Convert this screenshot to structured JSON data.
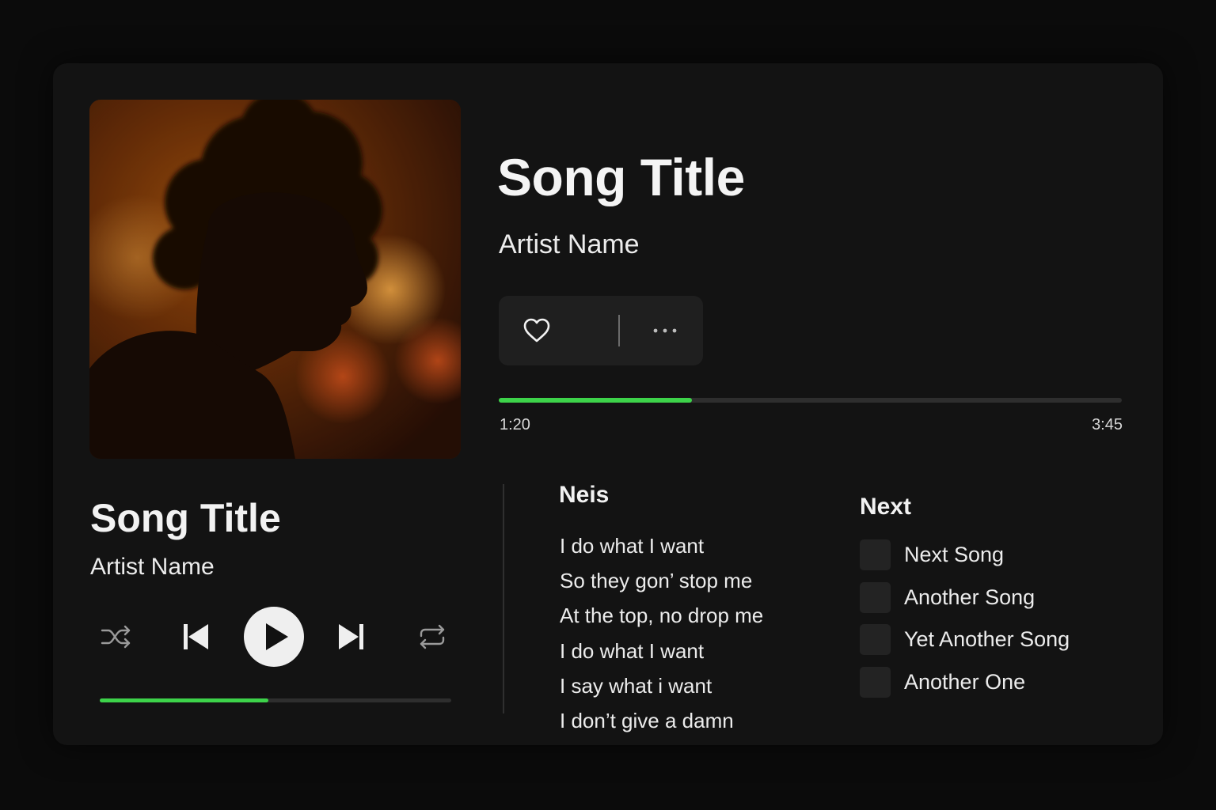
{
  "player": {
    "title": "Song Title",
    "artist": "Artist Name",
    "progress_fraction": 0.31,
    "time_current": "1:20",
    "time_total": "3:45",
    "mini_progress_fraction": 0.48
  },
  "actions": {
    "like_icon": "heart-icon",
    "more_icon": "more-dots-icon"
  },
  "controls": {
    "shuffle_icon": "shuffle-icon",
    "prev_icon": "skip-previous-icon",
    "play_icon": "play-icon",
    "next_icon": "skip-next-icon",
    "repeat_icon": "repeat-icon"
  },
  "lyrics": {
    "heading": "Neis",
    "lines": [
      "I do what I want",
      "So they gon’ stop me",
      "At the top, no drop me",
      "I do what I want",
      "I say what i want",
      "I don’t give a damn"
    ]
  },
  "up_next": {
    "heading": "Next",
    "items": [
      {
        "label": "Next Song"
      },
      {
        "label": "Another Song"
      },
      {
        "label": "Yet Another Song"
      },
      {
        "label": "Another One"
      }
    ]
  },
  "colors": {
    "accent": "#3dd34a",
    "background": "#0b0b0b",
    "card": "#131313"
  }
}
